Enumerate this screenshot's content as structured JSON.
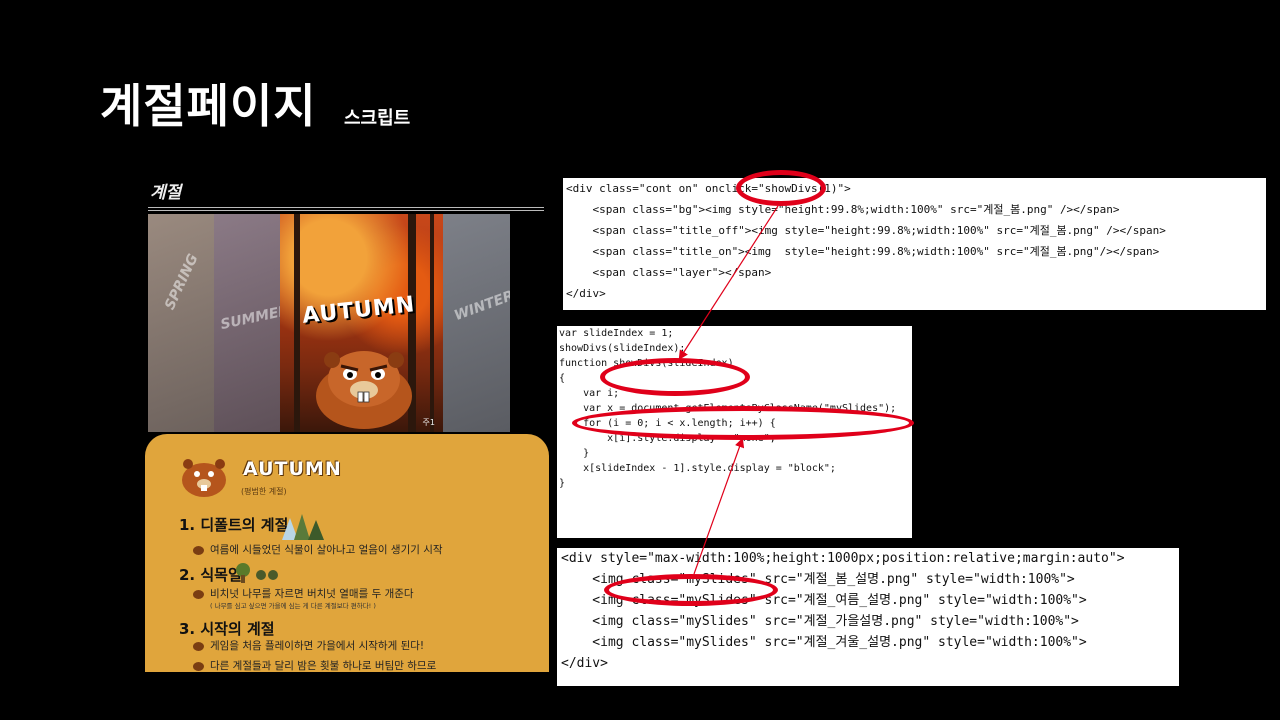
{
  "title": "계절페이지",
  "subtitle": "스크립트",
  "preview": {
    "season_label": "계절",
    "panels": [
      "SPRING",
      "SUMMER",
      "AUTUMN",
      "WINTER"
    ],
    "watermark": "주1"
  },
  "card": {
    "title": "AUTUMN",
    "subtitle": "(평범한 계절)",
    "sections": [
      {
        "heading": "1. 디폴트의 계절",
        "bullets": [
          "여름에 시들었던 식물이 살아나고 얼음이 생기기 시작"
        ]
      },
      {
        "heading": "2. 식목일",
        "bullets": [
          "비치넛 나무를 자르면 버치넛 열매를 두 개준다"
        ],
        "note": "( 나무를 심고 싶으면 가을에 심는 게 다른 계절보다 편하다! )"
      },
      {
        "heading": "3. 시작의 계절",
        "bullets": [
          "게임을 처음 플레이하면 가을에서 시작하게 된다!",
          "다른 계절들과 달리 밤은 횟불 하나로 버팀만 하므로"
        ]
      }
    ]
  },
  "code1": [
    "<div class=\"cont on\" onclick=\"showDivs(1)\">",
    "    <span class=\"bg\"><img style=\"height:99.8%;width:100%\" src=\"계절_봄.png\" /></span>",
    "    <span class=\"title_off\"><img style=\"height:99.8%;width:100%\" src=\"계절_봄.png\" /></span>",
    "    <span class=\"title_on\"><img  style=\"height:99.8%;width:100%\" src=\"계절_봄.png\"/></span>",
    "    <span class=\"layer\"></span>",
    "</div>"
  ],
  "code2": [
    "var slideIndex = 1;",
    "showDivs(slideIndex);",
    "",
    "function showDivs(slideIndex)",
    "{",
    "    var i;",
    "    var x = document.getElementsByClassName(\"mySlides\");",
    "",
    "    for (i = 0; i < x.length; i++) {",
    "        x[i].style.display = \"none\";",
    "    }",
    "",
    "    x[slideIndex - 1].style.display = \"block\";",
    "}"
  ],
  "code3": [
    "<div style=\"max-width:100%;height:1000px;position:relative;margin:auto\">",
    "    <img class=\"mySlides\" src=\"계절_봄_설명.png\" style=\"width:100%\">",
    "    <img class=\"mySlides\" src=\"계절_여름_설명.png\" style=\"width:100%\">",
    "    <img class=\"mySlides\" src=\"계절_가을설명.png\" style=\"width:100%\">",
    "    <img class=\"mySlides\" src=\"계절_겨울_설명.png\" style=\"width:100%\">",
    "</div>"
  ],
  "colors": {
    "background": "#000000",
    "card": "#e0a53c",
    "highlight": "#e0001a",
    "code_value": "#1a2ad6",
    "code_attr": "#b7141e"
  }
}
